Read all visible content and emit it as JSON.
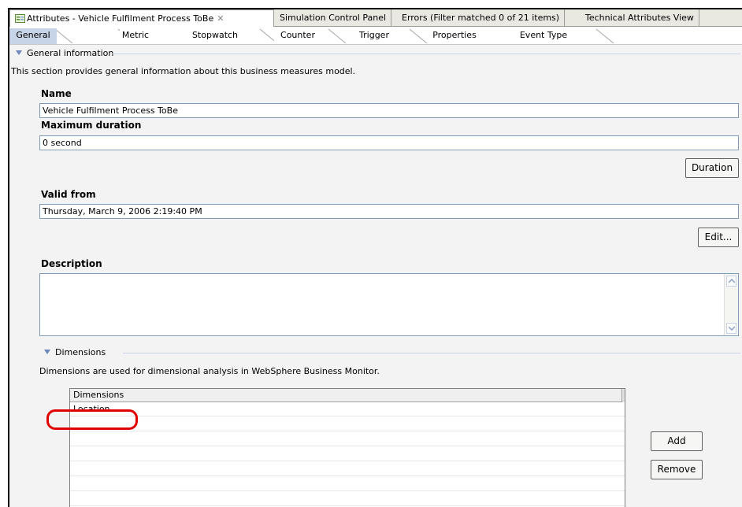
{
  "view_tabs": [
    {
      "label": "Attributes - Vehicle Fulfilment Process ToBe",
      "active": true
    },
    {
      "label": "Simulation Control Panel",
      "active": false
    },
    {
      "label": "Errors (Filter matched 0 of 21 items)",
      "active": false
    },
    {
      "label": "Technical Attributes View",
      "active": false
    }
  ],
  "sub_tabs": [
    "General",
    "Metric",
    "Stopwatch",
    "Counter",
    "Trigger",
    "Properties",
    "Event Type"
  ],
  "general": {
    "section_title": "General information",
    "section_description": "This section provides general information about this business measures model.",
    "name_label": "Name",
    "name_value": "Vehicle Fulfilment Process ToBe",
    "max_duration_label": "Maximum duration",
    "max_duration_value": "0 second",
    "duration_button": "Duration",
    "valid_from_label": "Valid from",
    "valid_from_value": "Thursday, March 9, 2006 2:19:40 PM",
    "edit_button": "Edit...",
    "description_label": "Description",
    "description_value": ""
  },
  "dimensions": {
    "section_title": "Dimensions",
    "section_description": "Dimensions are used for dimensional analysis in WebSphere Business Monitor.",
    "table_header": "Dimensions",
    "rows": [
      "Location"
    ],
    "add_button": "Add",
    "remove_button": "Remove"
  },
  "colors": {
    "active_subtab": "#c7d3e6",
    "highlight": "#e00000",
    "section_triangle": "#6c87b8"
  }
}
